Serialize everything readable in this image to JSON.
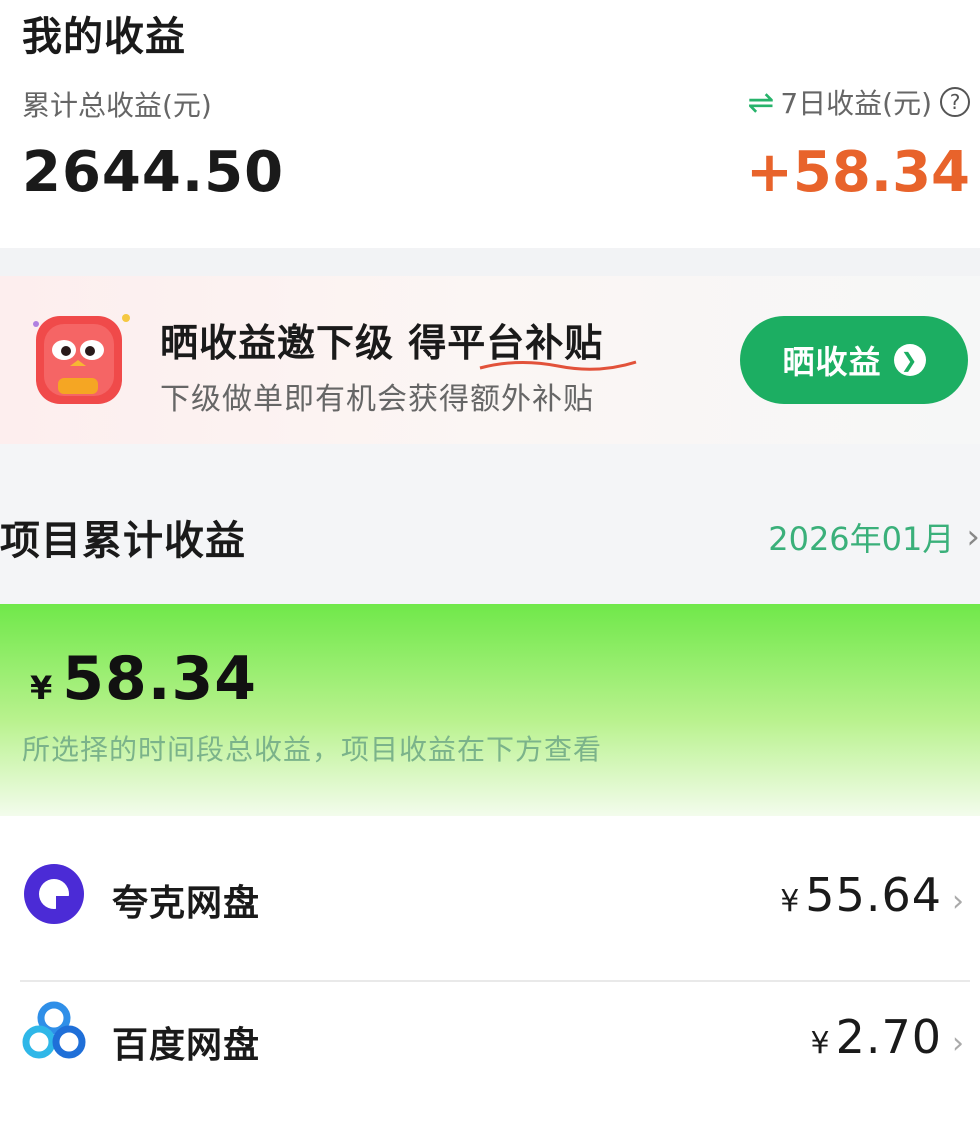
{
  "header": {
    "title": "我的收益"
  },
  "summary": {
    "total_label": "累计总收益(元)",
    "total_value": "2644.50",
    "seven_day_label": "7日收益(元)",
    "seven_day_value": "+58.34",
    "swap_icon": "swap-arrows-icon",
    "help_icon": "question-circle-icon",
    "help_glyph": "?"
  },
  "promo": {
    "title": "晒收益邀下级 得平台补贴",
    "subtitle": "下级做单即有机会获得额外补贴",
    "button_label": "晒收益",
    "button_icon": "chevron-right-circle-icon"
  },
  "project_section": {
    "title": "项目累计收益",
    "month": "2026年01月",
    "chevron": "›"
  },
  "period_card": {
    "currency": "¥",
    "value": "58.34",
    "note": "所选择的时间段总收益，项目收益在下方查看"
  },
  "projects": [
    {
      "name": "夸克网盘",
      "currency": "¥",
      "amount": "55.64",
      "icon": "quark-logo-icon",
      "chevron": "›"
    },
    {
      "name": "百度网盘",
      "currency": "¥",
      "amount": "2.70",
      "icon": "baidu-netdisk-logo-icon",
      "chevron": "›"
    }
  ],
  "colors": {
    "accent_green": "#1cae62",
    "positive_orange": "#e8632b",
    "month_green": "#3ab07a",
    "quark_purple": "#4b2bd6",
    "baidu_blue": "#2f8fe8"
  }
}
